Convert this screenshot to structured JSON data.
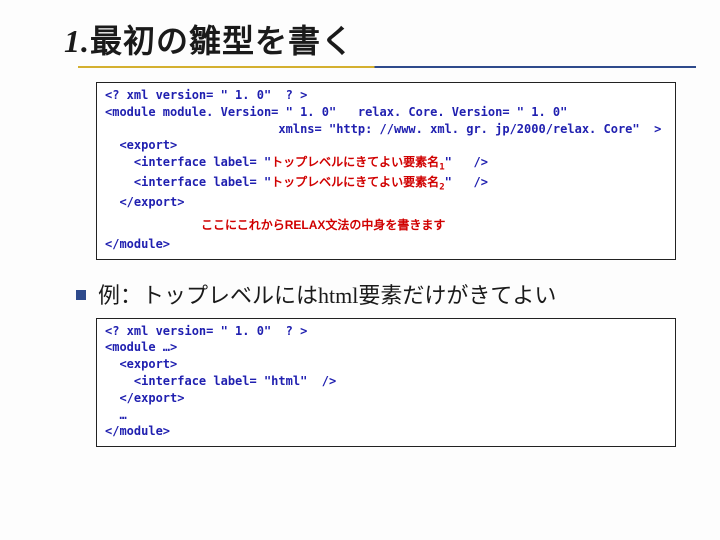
{
  "title": {
    "number": "1.",
    "text_jp": "最初の雛型を書く"
  },
  "code1": {
    "line1": "<? xml version= \" 1. 0\"  ? >",
    "line2": "<module module. Version= \" 1. 0\"   relax. Core. Version= \" 1. 0\"",
    "line3": "                        xmlns= \"http: //www. xml. gr. jp/2000/relax. Core\"  >",
    "line4": "  <export>",
    "line5_a": "    <interface label= \"",
    "line5_red": "トップレベルにきてよい要素名",
    "line5_sub": "1",
    "line5_b": "\"   />",
    "line6_a": "    <interface label= \"",
    "line6_red": "トップレベルにきてよい要素名",
    "line6_sub": "2",
    "line6_b": "\"   />",
    "line7": "  </export>",
    "note": "ここにこれからRELAX文法の中身を書きます",
    "line8": "</module>"
  },
  "bullet": {
    "text_jp_1": "例：トップレベルには",
    "text_en": "html",
    "text_jp_2": "要素だけがきてよい"
  },
  "code2": {
    "line1": "<? xml version= \" 1. 0\"  ? >",
    "line2": "<module …>",
    "line3": "  <export>",
    "line4": "    <interface label= \"html\"  />",
    "line5": "  </export>",
    "line6": "  …",
    "line7": "</module>"
  }
}
